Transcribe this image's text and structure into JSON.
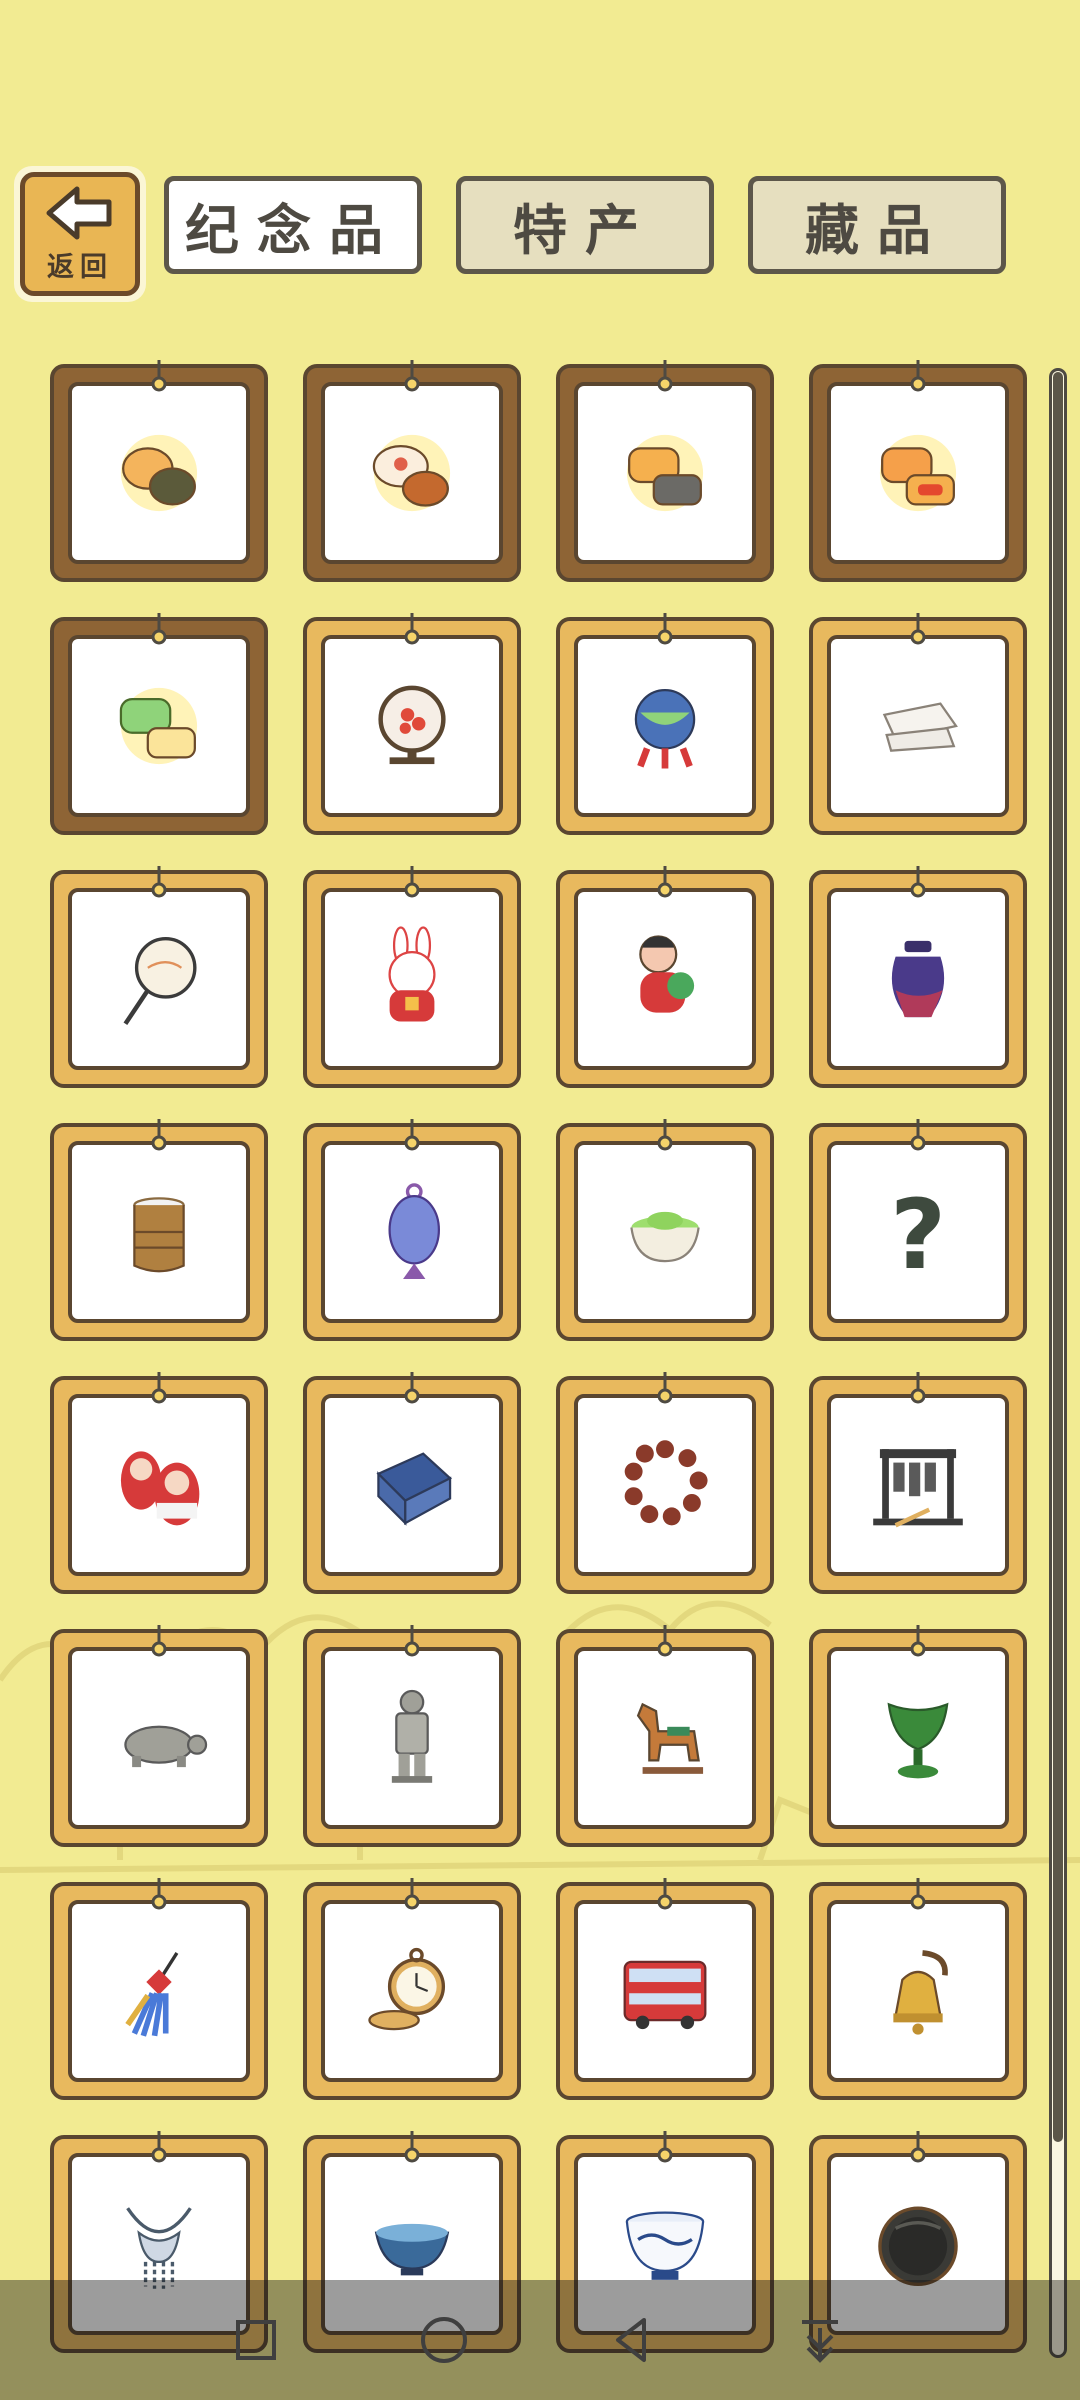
{
  "header": {
    "back_label": "返回",
    "tabs": [
      {
        "label": "纪念品",
        "active": true
      },
      {
        "label": "特产",
        "active": false
      },
      {
        "label": "藏品",
        "active": false
      }
    ]
  },
  "items": [
    {
      "icon": "mooncake-white-icon",
      "frame": "wood"
    },
    {
      "icon": "mooncake-red-bean-icon",
      "frame": "wood"
    },
    {
      "icon": "mooncake-nut-icon",
      "frame": "wood"
    },
    {
      "icon": "mooncake-egg-yolk-icon",
      "frame": "wood"
    },
    {
      "icon": "mooncake-green-icon",
      "frame": "wood"
    },
    {
      "icon": "embroidery-screen-icon",
      "frame": "gold"
    },
    {
      "icon": "embroidered-ball-icon",
      "frame": "gold"
    },
    {
      "icon": "silk-cloth-icon",
      "frame": "gold"
    },
    {
      "icon": "round-fan-icon",
      "frame": "gold"
    },
    {
      "icon": "rabbit-figurine-icon",
      "frame": "gold"
    },
    {
      "icon": "clay-doll-icon",
      "frame": "gold"
    },
    {
      "icon": "purple-jar-icon",
      "frame": "gold"
    },
    {
      "icon": "bamboo-cup-icon",
      "frame": "gold"
    },
    {
      "icon": "cloisonne-vase-icon",
      "frame": "gold"
    },
    {
      "icon": "matcha-bowl-icon",
      "frame": "gold"
    },
    {
      "icon": "question-mark-icon",
      "frame": "gold"
    },
    {
      "icon": "matryoshka-doll-icon",
      "frame": "gold"
    },
    {
      "icon": "batik-cloth-icon",
      "frame": "gold"
    },
    {
      "icon": "prayer-beads-icon",
      "frame": "gold"
    },
    {
      "icon": "bianzhong-bells-icon",
      "frame": "gold"
    },
    {
      "icon": "stone-turtle-icon",
      "frame": "gold"
    },
    {
      "icon": "terracotta-warrior-icon",
      "frame": "gold"
    },
    {
      "icon": "tang-horse-icon",
      "frame": "gold"
    },
    {
      "icon": "jade-cup-icon",
      "frame": "gold"
    },
    {
      "icon": "tassel-knot-icon",
      "frame": "gold"
    },
    {
      "icon": "pocket-watch-icon",
      "frame": "gold"
    },
    {
      "icon": "double-decker-bus-icon",
      "frame": "gold"
    },
    {
      "icon": "bronze-bell-icon",
      "frame": "gold"
    },
    {
      "icon": "silver-necklace-icon",
      "frame": "gold"
    },
    {
      "icon": "blue-tea-bowl-icon",
      "frame": "gold"
    },
    {
      "icon": "porcelain-bowl-icon",
      "frame": "gold"
    },
    {
      "icon": "inkstone-icon",
      "frame": "gold"
    }
  ],
  "colors": {
    "background": "#f2eb92",
    "wood_frame": "#8e6435",
    "gold_frame": "#e8b95e",
    "outline": "#5a4630"
  }
}
